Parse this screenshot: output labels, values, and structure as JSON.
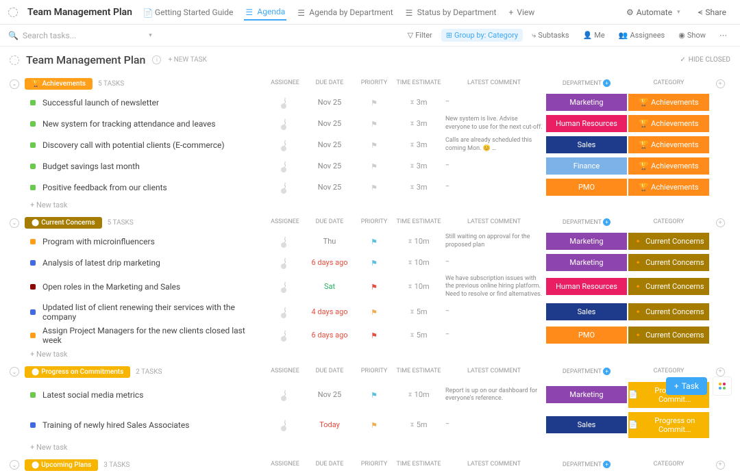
{
  "topbar": {
    "title": "Team Management Plan",
    "tabs": [
      {
        "label": "Getting Started Guide"
      },
      {
        "label": "Agenda",
        "active": true
      },
      {
        "label": "Agenda by Department"
      },
      {
        "label": "Status by Department"
      }
    ],
    "addView": "View",
    "automate": "Automate",
    "share": "Share"
  },
  "toolbar": {
    "searchPlaceholder": "Search tasks...",
    "filter": "Filter",
    "groupBy": "Group by: Category",
    "subtasks": "Subtasks",
    "me": "Me",
    "assignees": "Assignees",
    "show": "Show"
  },
  "main": {
    "title": "Team Management Plan",
    "newTask": "+ NEW TASK",
    "hideClosed": "HIDE CLOSED"
  },
  "columns": {
    "assignee": "ASSIGNEE",
    "dueDate": "DUE DATE",
    "priority": "PRIORITY",
    "timeEstimate": "TIME ESTIMATE",
    "latestComment": "LATEST COMMENT",
    "department": "DEPARTMENT",
    "category": "CATEGORY"
  },
  "sections": [
    {
      "name": "Achievements",
      "badgeClass": "achievements",
      "icon": "🏆",
      "count": "5 TASKS",
      "tasks": [
        {
          "sq": "sq-green",
          "name": "Successful launch of newsletter",
          "due": "Nov 25",
          "dueClass": "",
          "flag": "flag-gray",
          "time": "3m",
          "comment": "–",
          "dept": "Marketing",
          "deptClass": "dept-marketing",
          "cat": "Achievements",
          "catClass": "cat-achievements",
          "catIcon": "🏆"
        },
        {
          "sq": "sq-green",
          "name": "New system for tracking attendance and leaves",
          "due": "Nov 25",
          "dueClass": "",
          "flag": "flag-gray",
          "time": "3m",
          "comment": "New system is live. Advise everyone to use for the next cut-off.",
          "dept": "Human Resources",
          "deptClass": "dept-hr",
          "cat": "Achievements",
          "catClass": "cat-achievements",
          "catIcon": "🏆"
        },
        {
          "sq": "sq-green",
          "name": "Discovery call with potential clients (E-commerce)",
          "due": "Nov 25",
          "dueClass": "",
          "flag": "flag-gray",
          "time": "3m",
          "comment": "Calls are already scheduled this coming Mon. 😊 …",
          "dept": "Sales",
          "deptClass": "dept-sales",
          "cat": "Achievements",
          "catClass": "cat-achievements",
          "catIcon": "🏆"
        },
        {
          "sq": "sq-green",
          "name": "Budget savings last month",
          "due": "Nov 25",
          "dueClass": "",
          "flag": "flag-gray",
          "time": "3m",
          "comment": "–",
          "dept": "Finance",
          "deptClass": "dept-finance",
          "cat": "Achievements",
          "catClass": "cat-achievements",
          "catIcon": "🏆"
        },
        {
          "sq": "sq-green",
          "name": "Positive feedback from our clients",
          "due": "Nov 25",
          "dueClass": "",
          "flag": "flag-gray",
          "time": "3m",
          "comment": "–",
          "dept": "PMO",
          "deptClass": "dept-pmo",
          "cat": "Achievements",
          "catClass": "cat-achievements",
          "catIcon": "🏆"
        }
      ],
      "newTask": "+ New task"
    },
    {
      "name": "Current Concerns",
      "badgeClass": "concerns",
      "icon": "⬤",
      "count": "5 TASKS",
      "tasks": [
        {
          "sq": "sq-orange",
          "name": "Program with microinfluencers",
          "due": "Thu",
          "dueClass": "",
          "flag": "flag-blue",
          "time": "10m",
          "comment": "Still waiting on approval for the proposed plan",
          "dept": "Marketing",
          "deptClass": "dept-marketing",
          "cat": "Current Concerns",
          "catClass": "cat-concerns",
          "catIcon": "🔸"
        },
        {
          "sq": "sq-blue",
          "name": "Analysis of latest drip marketing",
          "due": "6 days ago",
          "dueClass": "due-red",
          "flag": "flag-blue",
          "time": "10m",
          "comment": "–",
          "dept": "Marketing",
          "deptClass": "dept-marketing",
          "cat": "Current Concerns",
          "catClass": "cat-concerns",
          "catIcon": "🔸"
        },
        {
          "sq": "sq-darkred",
          "name": "Open roles in the Marketing and Sales",
          "due": "Sat",
          "dueClass": "due-green",
          "flag": "flag-red",
          "time": "10m",
          "comment": "We have subscription issues with the previous online hiring platform. Need to resolve or find alternatives.",
          "dept": "Human Resources",
          "deptClass": "dept-hr",
          "cat": "Current Concerns",
          "catClass": "cat-concerns",
          "catIcon": "🔸"
        },
        {
          "sq": "sq-blue",
          "name": "Updated list of client renewing their services with the company",
          "due": "4 days ago",
          "dueClass": "due-red",
          "flag": "flag-yellow",
          "time": "5m",
          "comment": "–",
          "dept": "Sales",
          "deptClass": "dept-sales",
          "cat": "Current Concerns",
          "catClass": "cat-concerns",
          "catIcon": "🔸"
        },
        {
          "sq": "sq-orange",
          "name": "Assign Project Managers for the new clients closed last week",
          "due": "6 days ago",
          "dueClass": "due-red",
          "flag": "flag-red",
          "time": "5m",
          "comment": "–",
          "dept": "PMO",
          "deptClass": "dept-pmo",
          "cat": "Current Concerns",
          "catClass": "cat-concerns",
          "catIcon": "🔸"
        }
      ],
      "newTask": "+ New task"
    },
    {
      "name": "Progress on Commitments",
      "badgeClass": "progress",
      "icon": "⬤",
      "count": "2 TASKS",
      "tasks": [
        {
          "sq": "sq-green",
          "name": "Latest social media metrics",
          "due": "Nov 25",
          "dueClass": "",
          "flag": "flag-blue",
          "time": "10m",
          "comment": "Report is up on our dashboard for everyone's reference.",
          "dept": "Marketing",
          "deptClass": "dept-marketing",
          "cat": "Progress on Commit...",
          "catClass": "cat-progress",
          "catIcon": "📄"
        },
        {
          "sq": "sq-blue",
          "name": "Training of newly hired Sales Associates",
          "due": "Today",
          "dueClass": "due-red",
          "flag": "flag-yellow",
          "time": "5m",
          "comment": "–",
          "dept": "Sales",
          "deptClass": "dept-sales",
          "cat": "Progress on Commit...",
          "catClass": "cat-progress",
          "catIcon": "📄"
        }
      ],
      "newTask": "+ New task"
    },
    {
      "name": "Upcoming Plans",
      "badgeClass": "upcoming",
      "icon": "⬤",
      "count": "3 TASKS",
      "tasks": [],
      "newTask": ""
    }
  ],
  "fab": {
    "task": "Task"
  }
}
